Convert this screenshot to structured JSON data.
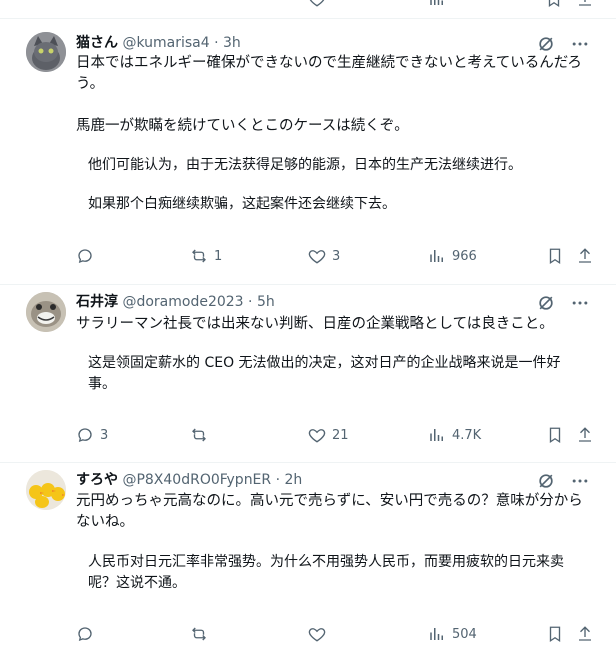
{
  "tweets": [
    {
      "name": "猫さん",
      "handle": "@kumarisa4",
      "dot": "·",
      "time": "3h",
      "text": "日本ではエネルギー確保ができないので生産継続できないと考えているんだろう。",
      "text2": "馬鹿一が欺瞞を続けていくとこのケースは続くぞ。",
      "translation": "他们可能认为，由于无法获得足够的能源，日本的生产无法继续进行。",
      "translation2": "如果那个白痴继续欺骗，这起案件还会继续下去。",
      "replies": "",
      "reposts": "1",
      "likes": "3",
      "views": "966"
    },
    {
      "name": "石井淳",
      "handle": "@doramode2023",
      "dot": "·",
      "time": "5h",
      "text": "サラリーマン社長では出来ない判断、日産の企業戦略としては良きこと。",
      "translation": "这是领固定薪水的 CEO 无法做出的决定，这对日产的企业战略来说是一件好事。",
      "replies": "3",
      "reposts": "",
      "likes": "21",
      "views": "4.7K"
    },
    {
      "name": "すろや",
      "handle": "@P8X40dRO0FypnER",
      "dot": "·",
      "time": "2h",
      "text": "元円めっちゃ元高なのに。高い元で売らずに、安い円で売るの？意味が分からないね。",
      "translation": "人民币对日元汇率非常强势。为什么不用强势人民币，而要用疲软的日元来卖呢？这说不通。",
      "replies": "",
      "reposts": "",
      "likes": "",
      "views": "504"
    }
  ],
  "colors": {
    "text": "#0f1419",
    "secondary": "#536471",
    "divider": "#eff3f4"
  }
}
